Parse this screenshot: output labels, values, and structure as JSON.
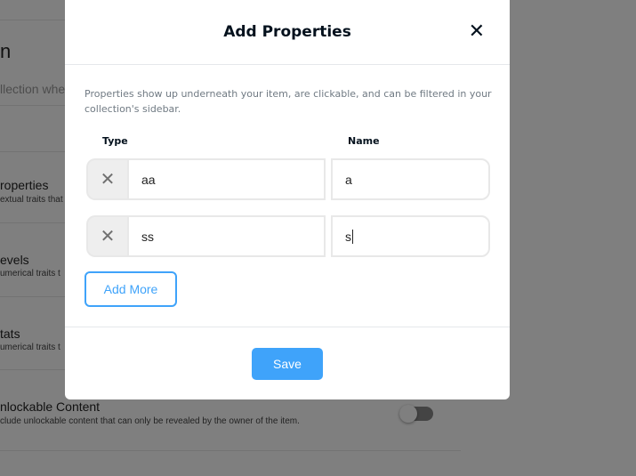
{
  "background": {
    "title_fragment": "n",
    "subtitle_fragment": "llection wher",
    "sections": [
      {
        "title": "roperties",
        "desc": "extual traits that"
      },
      {
        "title": "evels",
        "desc": "umerical traits t"
      },
      {
        "title": "tats",
        "desc": "umerical traits t"
      },
      {
        "title": "nlockable Content",
        "desc": "clude unlockable content that can only be revealed by the owner of the item."
      }
    ],
    "unlockable_toggle_on": false
  },
  "modal": {
    "title": "Add Properties",
    "close_icon": "close-icon",
    "description": "Properties show up underneath your item, are clickable, and can be filtered in your collection's sidebar.",
    "type_label": "Type",
    "name_label": "Name",
    "rows": [
      {
        "type": "aa",
        "name": "a"
      },
      {
        "type": "ss",
        "name": "s"
      }
    ],
    "remove_glyph": "✕",
    "add_more_label": "Add More",
    "save_label": "Save",
    "accent_color": "#3fa3fa"
  }
}
